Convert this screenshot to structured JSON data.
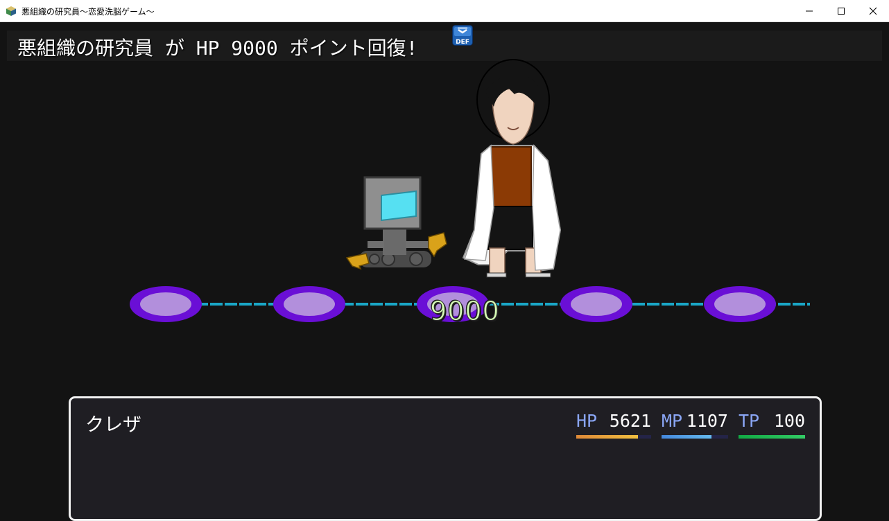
{
  "window": {
    "title": "悪組織の研究員～恋愛洗脳ゲーム～",
    "icon": "game-app-icon",
    "buttons": [
      "minimize-icon",
      "maximize-icon",
      "close-icon"
    ]
  },
  "battle_log": {
    "message": "悪組織の研究員 が HP 9000 ポイント回復!",
    "state_badge": "DEF"
  },
  "popup": {
    "damage_value": "9000",
    "color": "#d6ffb6"
  },
  "stage": {
    "node_count": 5,
    "node_color": "#6a0fd6",
    "node_inner_color": "#b28fdc",
    "connector_color": "#1aa7c7"
  },
  "status": {
    "actor_name": "クレザ",
    "gauges": [
      {
        "label": "HP",
        "value": "5621",
        "level": 0.82,
        "colors": [
          "#e08a38",
          "#f0c040"
        ]
      },
      {
        "label": "MP",
        "value": "1107",
        "level": 0.75,
        "colors": [
          "#4488dd",
          "#66bbee"
        ]
      },
      {
        "label": "TP",
        "value": "100",
        "level": 1.0,
        "colors": [
          "#11aa44",
          "#33cc66"
        ]
      }
    ]
  }
}
